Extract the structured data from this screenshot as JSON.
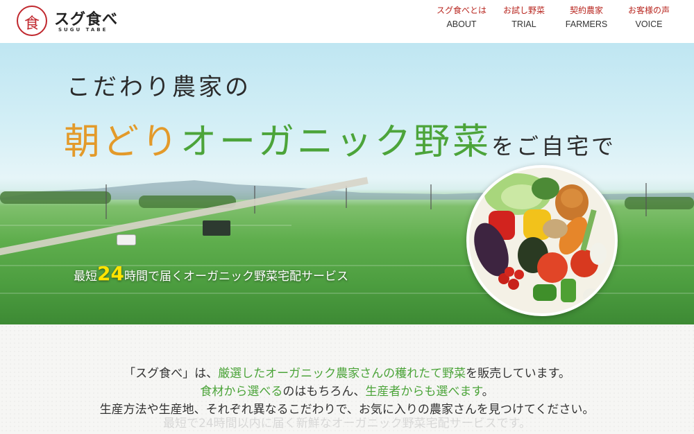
{
  "header": {
    "logo_mark_char": "食",
    "logo_name": "スグ食べ",
    "logo_sub": "SUGU TABE",
    "nav": [
      {
        "jp": "スグ食べとは",
        "en": "ABOUT"
      },
      {
        "jp": "お試し野菜",
        "en": "TRIAL"
      },
      {
        "jp": "契約農家",
        "en": "FARMERS"
      },
      {
        "jp": "お客様の声",
        "en": "VOICE"
      }
    ]
  },
  "hero": {
    "line1": "こだわり農家の",
    "line2_asa": "朝どり",
    "line2_organic": "オーガニック野菜",
    "line2_rest": "をご自宅で",
    "tag_prefix": "最短",
    "tag_number": "24",
    "tag_suffix": "時間で届くオーガニック野菜宅配サービス"
  },
  "intro": {
    "p1_a": "「スグ食べ」は、",
    "p1_hl": "厳選したオーガニック農家さんの穫れたて野菜",
    "p1_b": "を販売しています。",
    "p2_hl1": "食材から選べる",
    "p2_a": "のはもちろん、",
    "p2_hl2": "生産者からも選べます",
    "p2_b": "。",
    "p3": "生産方法や生産地、それぞれ異なるこだわりで、お気に入りの農家さんを見つけてください。",
    "p4": "最短で24時間以内に届く新鮮なオーガニック野菜宅配サービスです。"
  },
  "colors": {
    "brand_red": "#c0272d",
    "accent_orange": "#e39a2a",
    "accent_green": "#4ca43a",
    "tag_yellow": "#ffe400"
  }
}
